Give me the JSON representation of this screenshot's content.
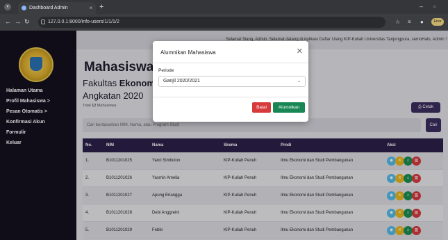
{
  "browser": {
    "tab_title": "Dashboard Admin",
    "url": "127.0.0.1:8000/info-users/1/1/1/2",
    "profile_label": "Error"
  },
  "sidebar": {
    "items": [
      {
        "label": "Halaman Utama"
      },
      {
        "label": "Profil Mahasiswa >"
      },
      {
        "label": "Pesan Otomatis >"
      },
      {
        "label": "Konfirmasi Akun"
      },
      {
        "label": "Formulir"
      },
      {
        "label": "Keluar"
      }
    ]
  },
  "header": {
    "welcome": "Selamat Siang, Admin. Selamat datang di Aplikasi Daftar Ulang KIP-Kuliah Universitas Tanjungpura, semoHalo, Admin !"
  },
  "main": {
    "title": "Mahasiswa A",
    "faculty_prefix": "Fakultas ",
    "faculty_name": "Ekonomi",
    "cohort": "Angkatan 2020",
    "total_prefix": "Total ",
    "total_count": "12",
    "total_suffix": " Mahasiswa",
    "print_label": "Cetak",
    "search_placeholder": "Cari berdasarkan NIM, Nama, atau Program Studi",
    "search_button": "Cari"
  },
  "table": {
    "headers": [
      "No.",
      "NIM",
      "Nama",
      "Skema",
      "Prodi",
      "Aksi"
    ],
    "rows": [
      {
        "no": "1.",
        "nim": "B1011201025",
        "nama": "Yanri Simbolon",
        "skema": "KIP-Kuliah Penuh",
        "prodi": "Ilmu Ekonomi dan Studi Pembangunan"
      },
      {
        "no": "2.",
        "nim": "B1011201026",
        "nama": "Yasmin Amelia",
        "skema": "KIP-Kuliah Penuh",
        "prodi": "Ilmu Ekonomi dan Studi Pembangunan"
      },
      {
        "no": "3.",
        "nim": "B1011201027",
        "nama": "Apung Erlangga",
        "skema": "KIP-Kuliah Penuh",
        "prodi": "Ilmu Ekonomi dan Studi Pembangunan"
      },
      {
        "no": "4.",
        "nim": "B1011201028",
        "nama": "Debi Anggreini",
        "skema": "KIP-Kuliah Penuh",
        "prodi": "Ilmu Ekonomi dan Studi Pembangunan"
      },
      {
        "no": "5.",
        "nim": "B1011201029",
        "nama": "Febbi",
        "skema": "KIP-Kuliah Penuh",
        "prodi": "Ilmu Ekonomi dan Studi Pembangunan"
      }
    ]
  },
  "modal": {
    "title": "Alumnikan Mahasiswa",
    "label": "Periode",
    "selected": "Ganjil 2020/2021",
    "cancel": "Batal",
    "confirm": "Alumnikan"
  },
  "colors": {
    "sidebar": "#14101f",
    "table_header": "#2b1f48",
    "confirm": "#198754",
    "cancel": "#d63a3a"
  },
  "icons": [
    "eye-icon",
    "close-icon",
    "graduate-icon",
    "trash-icon",
    "printer-icon",
    "lock-icon"
  ]
}
